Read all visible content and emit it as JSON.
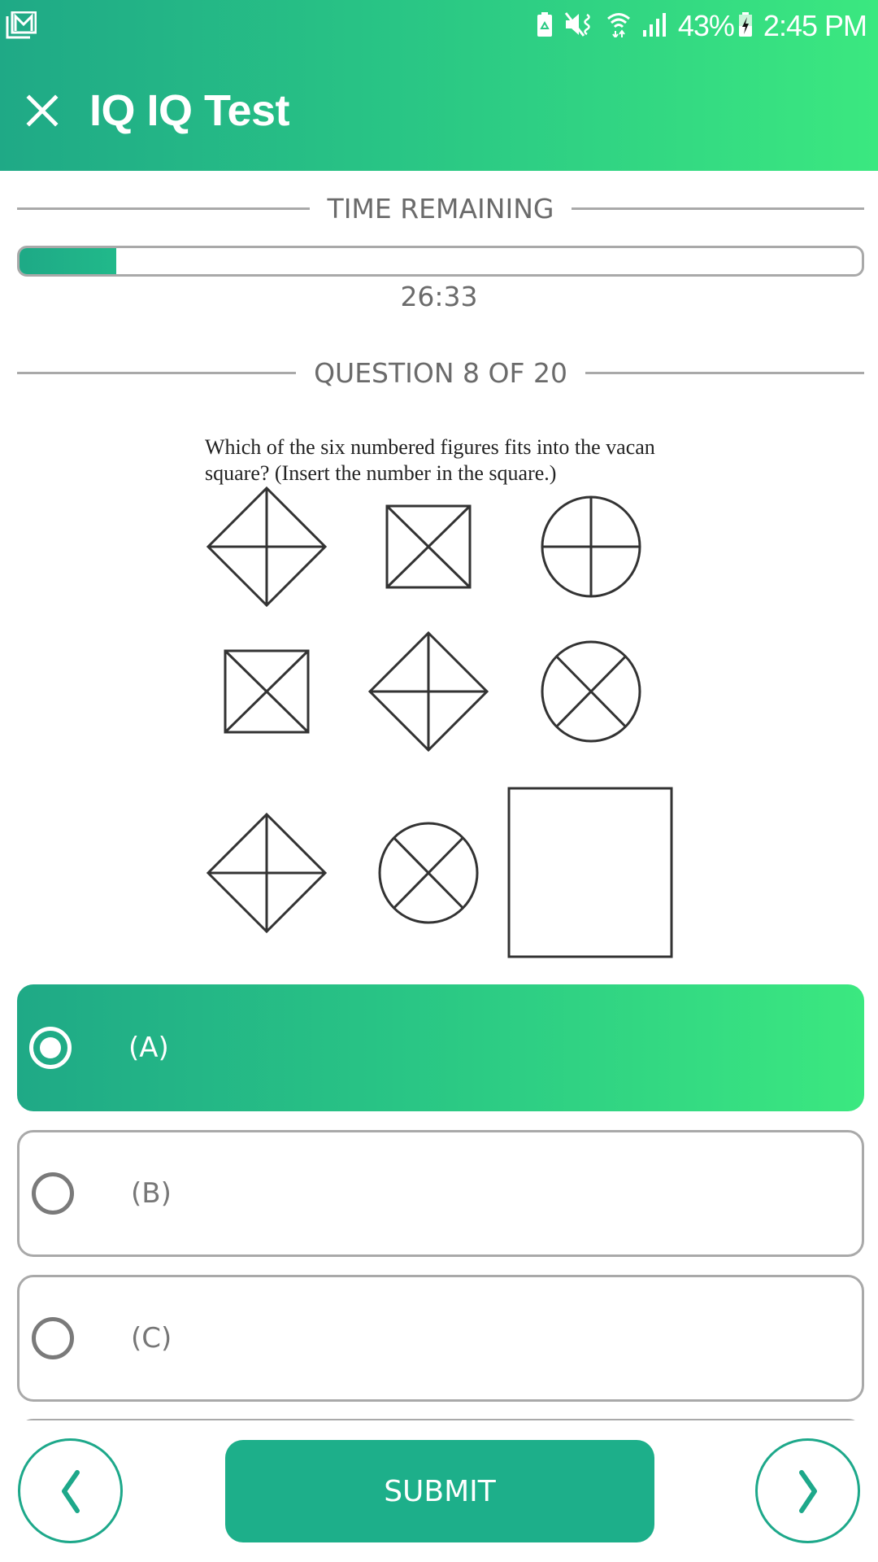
{
  "status_bar": {
    "left_icons": [
      "mail-notification-icon"
    ],
    "right_icons": [
      "battery-saver-icon",
      "mute-vibrate-icon",
      "wifi-icon",
      "cell-signal-icon"
    ],
    "battery_percent": "43%",
    "battery_icon": "battery-charging-icon",
    "time": "2:45 PM"
  },
  "header": {
    "close_icon": "close-icon",
    "title": "IQ IQ Test"
  },
  "timer": {
    "label": "TIME REMAINING",
    "elapsed_fraction": 0.115,
    "remaining": "26:33"
  },
  "question": {
    "counter_label": "QUESTION 8 OF 20",
    "current": 8,
    "total": 20,
    "text": "Which of the six numbered figures fits into the vacan square? (Insert the number in the square.)",
    "figure_grid": [
      [
        "diamond-cross",
        "square-x",
        "circle-cross"
      ],
      [
        "square-x",
        "diamond-cross",
        "circle-x"
      ],
      [
        "diamond-cross",
        "circle-x",
        "vacant-square"
      ]
    ]
  },
  "options": [
    {
      "label": "(A)",
      "selected": true
    },
    {
      "label": "(B)",
      "selected": false
    },
    {
      "label": "(C)",
      "selected": false
    },
    {
      "label": "",
      "selected": false
    }
  ],
  "footer": {
    "prev_icon": "chevron-left-icon",
    "submit_label": "SUBMIT",
    "next_icon": "chevron-right-icon"
  },
  "colors": {
    "accent": "#1daf8a",
    "gradient_start": "#1fa986",
    "gradient_end": "#3be880",
    "muted_text": "#6b6b6b",
    "border": "#a9a9a9"
  }
}
